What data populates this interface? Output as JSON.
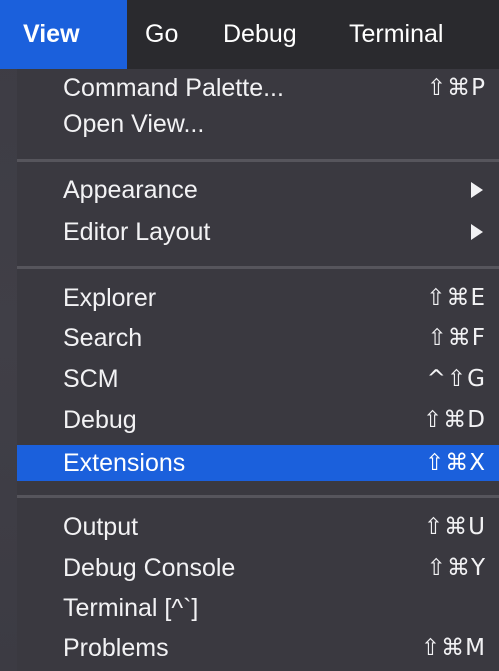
{
  "menubar": {
    "items": [
      {
        "label": "View"
      },
      {
        "label": "Go"
      },
      {
        "label": "Debug"
      },
      {
        "label": "Terminal"
      }
    ]
  },
  "view_menu": {
    "command_palette": {
      "label": "Command Palette...",
      "shortcut": "⇧⌘P"
    },
    "open_view": {
      "label": "Open View..."
    },
    "appearance": {
      "label": "Appearance"
    },
    "editor_layout": {
      "label": "Editor Layout"
    },
    "explorer": {
      "label": "Explorer",
      "shortcut": "⇧⌘E"
    },
    "search": {
      "label": "Search",
      "shortcut": "⇧⌘F"
    },
    "scm": {
      "label": "SCM",
      "shortcut": "^⇧G"
    },
    "debug": {
      "label": "Debug",
      "shortcut": "⇧⌘D"
    },
    "extensions": {
      "label": "Extensions",
      "shortcut": "⇧⌘X"
    },
    "output": {
      "label": "Output",
      "shortcut": "⇧⌘U"
    },
    "debug_console": {
      "label": "Debug Console",
      "shortcut": "⇧⌘Y"
    },
    "terminal": {
      "label": "Terminal [^`]"
    },
    "problems": {
      "label": "Problems",
      "shortcut": "⇧⌘M"
    }
  },
  "colors": {
    "highlight": "#1b60dc",
    "menubar_bg": "#2a2a2e",
    "menu_bg": "#3a3940"
  }
}
